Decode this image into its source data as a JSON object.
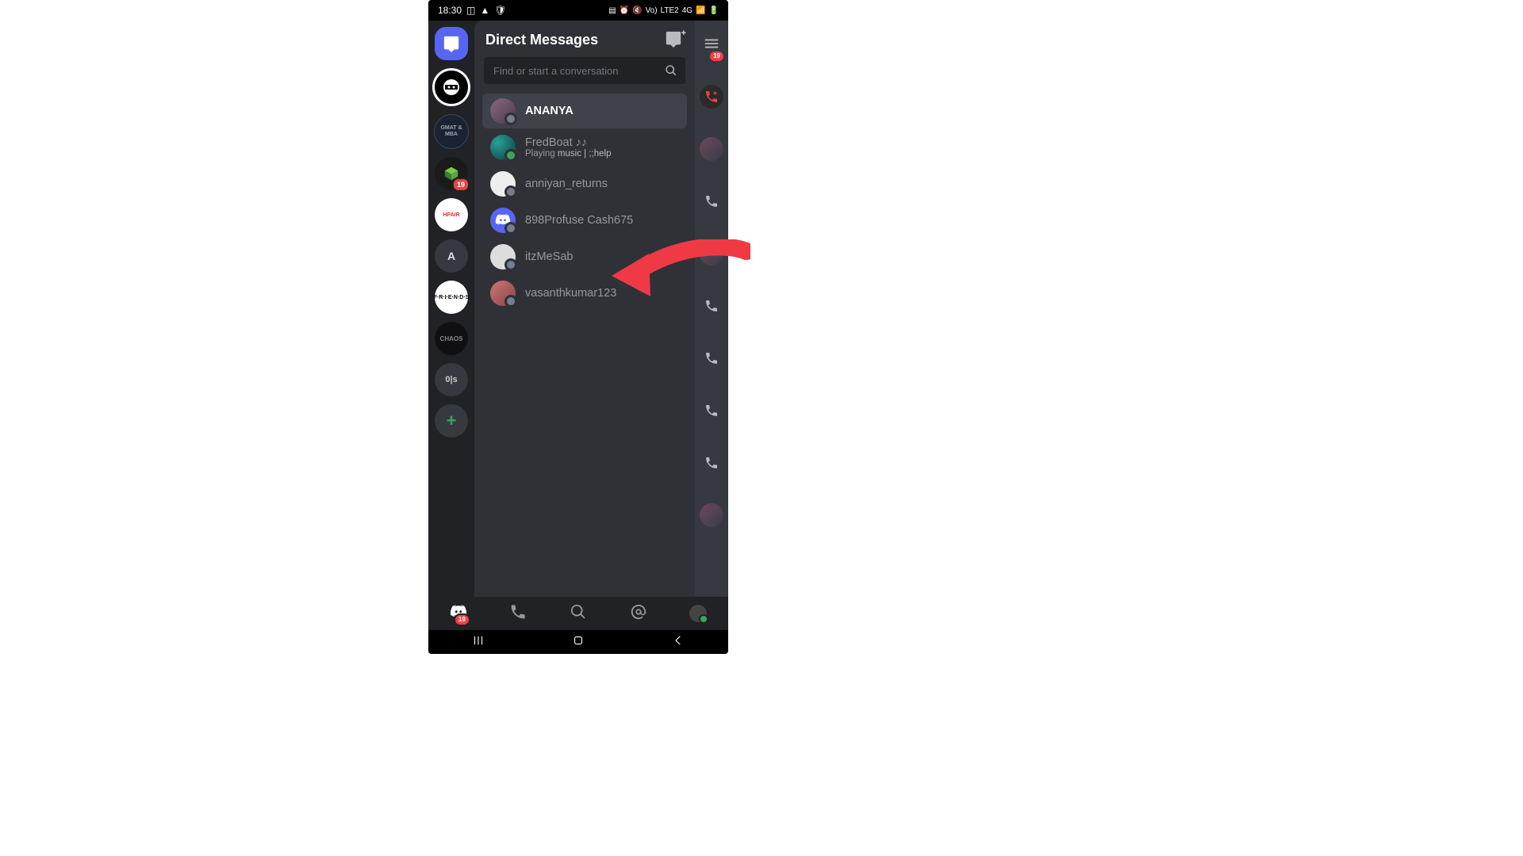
{
  "statusbar": {
    "time": "18:30",
    "net1": "Vo)",
    "net2": "LTE2",
    "net3": "4G"
  },
  "header": {
    "title": "Direct Messages"
  },
  "search": {
    "placeholder": "Find or start a conversation"
  },
  "servers": {
    "ninja": "",
    "gmat": "GMAT & MBA",
    "hpair": "HPAIR",
    "letterA": "A",
    "friends": "F·R·I·E·N·D·S",
    "chaos": "CHAOS",
    "ols": "0|s",
    "badge_cube": "19",
    "add": "+"
  },
  "dms": [
    {
      "name": "ANANYA",
      "selected": true,
      "status": "offline"
    },
    {
      "name": "FredBoat ♪♪",
      "sub_prefix": "Playing ",
      "sub_bold": "music | ;;help",
      "status": "online"
    },
    {
      "name": "anniyan_returns",
      "status": "offline"
    },
    {
      "name": "898Profuse Cash675",
      "avatar": "discord",
      "status": "offline"
    },
    {
      "name": "itzMeSab",
      "status": "offline"
    },
    {
      "name": "vasanthkumar123",
      "status": "offline"
    }
  ],
  "peek": {
    "burger_badge": "19"
  },
  "tabs": {
    "home_badge": "19"
  }
}
